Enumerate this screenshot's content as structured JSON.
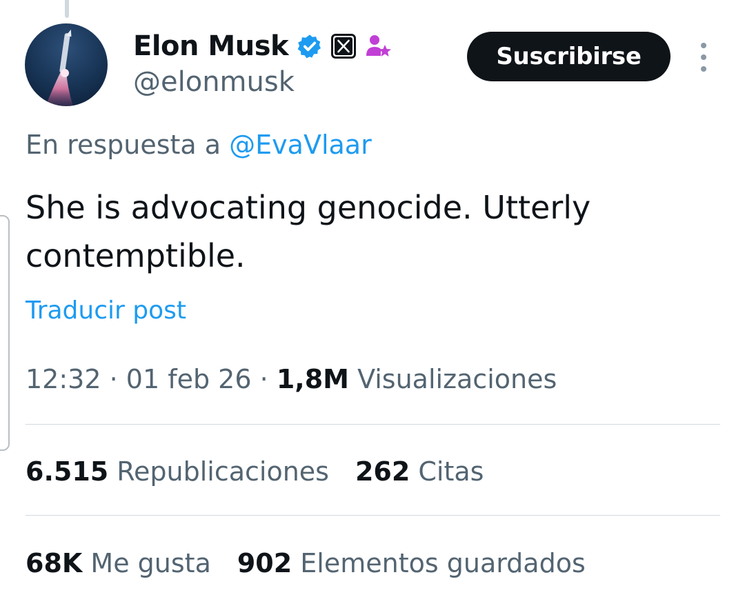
{
  "author": {
    "display_name": "Elon Musk",
    "handle": "@elonmusk"
  },
  "icons": {
    "avatar": "rocket-launch-avatar",
    "verified": "verified-badge-icon",
    "affiliate": "x-affiliate-badge-icon",
    "subscriber": "person-star-icon",
    "more": "more-vertical-icon"
  },
  "colors": {
    "link": "#1d9bf0",
    "text": "#0f1419",
    "muted": "#536471",
    "button": "#0f1419",
    "subscriber_badge": "#c13fd6"
  },
  "actions": {
    "subscribe_label": "Suscribirse"
  },
  "reply": {
    "prefix": "En respuesta a",
    "mention": "@EvaVlaar"
  },
  "post": {
    "text": "She is advocating genocide. Utterly contemptible.",
    "translate_label": "Traducir post"
  },
  "meta": {
    "time": "12:32",
    "date": "01 feb 26",
    "separator": "·",
    "views_count": "1,8M",
    "views_label": "Visualizaciones"
  },
  "stats": {
    "reposts": {
      "count": "6.515",
      "label": "Republicaciones"
    },
    "quotes": {
      "count": "262",
      "label": "Citas"
    },
    "likes": {
      "count": "68K",
      "label": "Me gusta"
    },
    "bookmarks": {
      "count": "902",
      "label": "Elementos guardados"
    }
  }
}
